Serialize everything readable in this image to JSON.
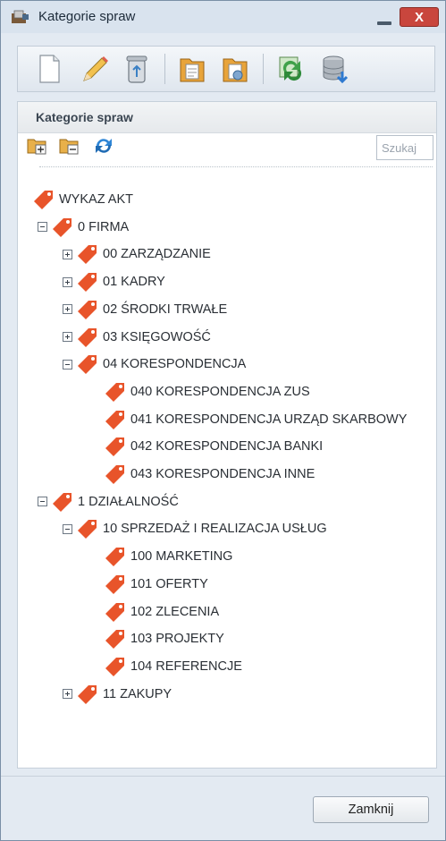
{
  "window": {
    "title": "Kategorie spraw",
    "close_label": "X"
  },
  "toolbar": {
    "buttons": [
      {
        "name": "new-document-icon",
        "tooltip": ""
      },
      {
        "name": "pencil-icon",
        "tooltip": ""
      },
      {
        "name": "recycle-bin-icon",
        "tooltip": ""
      },
      {
        "name": "folder-document-icon",
        "tooltip": ""
      },
      {
        "name": "folder-settings-icon",
        "tooltip": ""
      },
      {
        "name": "refresh-export-icon",
        "tooltip": ""
      },
      {
        "name": "database-download-icon",
        "tooltip": ""
      }
    ]
  },
  "panel": {
    "title": "Kategorie spraw",
    "tools": [
      "folder-add-icon",
      "folder-remove-icon",
      "refresh-icon"
    ],
    "search_placeholder": "Szukaj"
  },
  "tree": [
    {
      "label": "WYKAZ AKT",
      "level": 0,
      "toggle": "none"
    },
    {
      "label": "0 FIRMA",
      "level": 1,
      "toggle": "minus"
    },
    {
      "label": "00 ZARZĄDZANIE",
      "level": 2,
      "toggle": "plus"
    },
    {
      "label": "01 KADRY",
      "level": 2,
      "toggle": "plus"
    },
    {
      "label": "02 ŚRODKI TRWAŁE",
      "level": 2,
      "toggle": "plus"
    },
    {
      "label": "03 KSIĘGOWOŚĆ",
      "level": 2,
      "toggle": "plus"
    },
    {
      "label": "04 KORESPONDENCJA",
      "level": 2,
      "toggle": "minus"
    },
    {
      "label": "040 KORESPONDENCJA ZUS",
      "level": 3,
      "toggle": "none"
    },
    {
      "label": "041 KORESPONDENCJA URZĄD SKARBOWY",
      "level": 3,
      "toggle": "none"
    },
    {
      "label": "042 KORESPONDENCJA BANKI",
      "level": 3,
      "toggle": "none"
    },
    {
      "label": "043 KORESPONDENCJA INNE",
      "level": 3,
      "toggle": "none"
    },
    {
      "label": "1 DZIAŁALNOŚĆ",
      "level": 1,
      "toggle": "minus"
    },
    {
      "label": "10 SPRZEDAŻ I REALIZACJA USŁUG",
      "level": 2,
      "toggle": "minus"
    },
    {
      "label": "100 MARKETING",
      "level": 3,
      "toggle": "none"
    },
    {
      "label": "101 OFERTY",
      "level": 3,
      "toggle": "none"
    },
    {
      "label": "102 ZLECENIA",
      "level": 3,
      "toggle": "none"
    },
    {
      "label": "103 PROJEKTY",
      "level": 3,
      "toggle": "none"
    },
    {
      "label": "104 REFERENCJE",
      "level": 3,
      "toggle": "none"
    },
    {
      "label": "11 ZAKUPY",
      "level": 2,
      "toggle": "plus"
    }
  ],
  "footer": {
    "close_button": "Zamknij"
  },
  "colors": {
    "tag": "#e8542a",
    "close_button": "#c9463d"
  }
}
